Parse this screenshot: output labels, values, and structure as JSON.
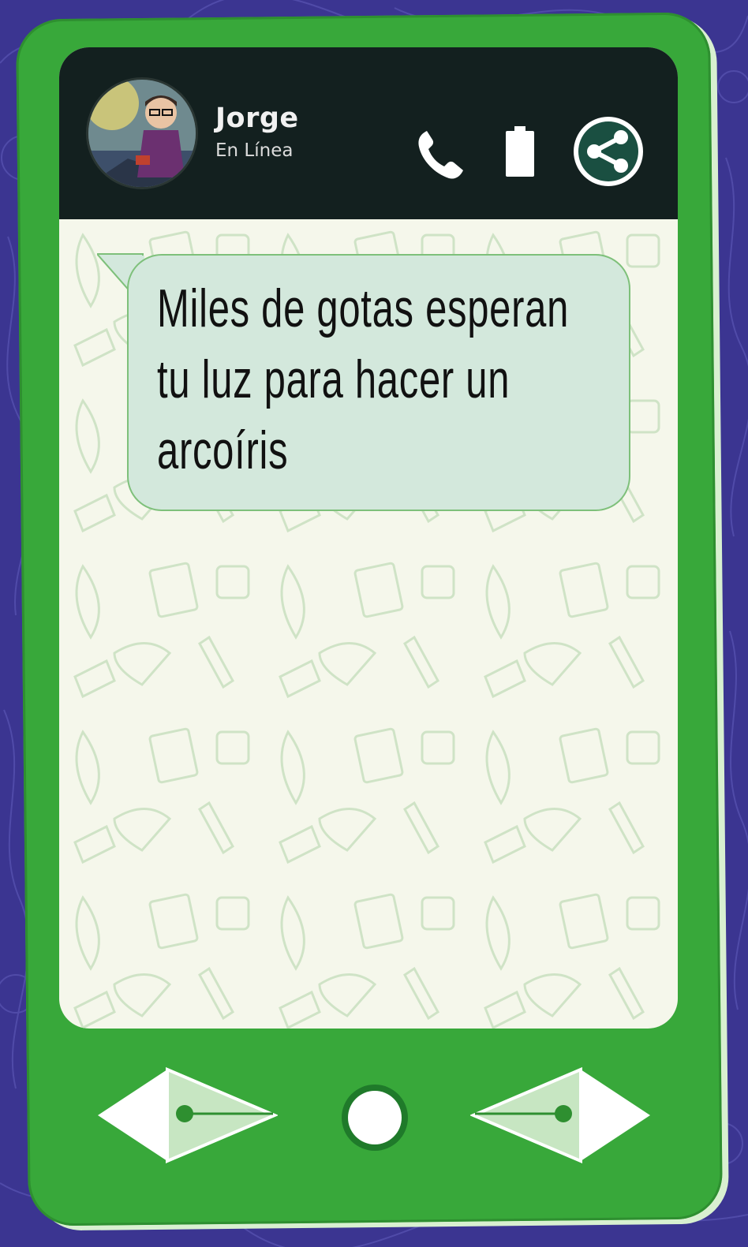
{
  "chat": {
    "contact_name": "Jorge",
    "status": "En Línea",
    "message": "Miles de gotas esperan tu luz para hacer un arcoíris"
  },
  "icons": {
    "avatar": "avatar-illustration",
    "call": "phone-icon",
    "battery": "battery-icon",
    "share": "share-icon",
    "back": "pen-nib-left-arrow-icon",
    "home": "home-circle-icon",
    "forward": "pen-nib-right-arrow-icon"
  },
  "colors": {
    "background": "#3b3591",
    "phone_body": "#38a83a",
    "header": "#13201f",
    "bubble": "#d3e8dc",
    "chat_background": "#f5f7eb"
  }
}
